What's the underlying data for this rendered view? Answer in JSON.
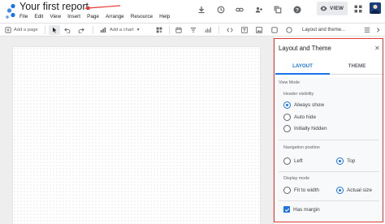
{
  "app": {
    "title": "Your first report",
    "menu": [
      "File",
      "Edit",
      "View",
      "Insert",
      "Page",
      "Arrange",
      "Resource",
      "Help"
    ],
    "top_icons": [
      "download-icon",
      "history-icon",
      "link-icon",
      "share-icon",
      "copy-icon",
      "help-icon"
    ],
    "view_button": "VIEW",
    "annotation_color": "#e53935",
    "accent": "#1a73e8"
  },
  "toolbar": {
    "add_page": "Add a page",
    "add_chart": "Add a chart",
    "theme_layout": "Layout and theme..."
  },
  "panel": {
    "title": "Layout and Theme",
    "tabs": {
      "layout": "LAYOUT",
      "theme": "THEME"
    },
    "view_mode": "View Mode",
    "header_visibility": "Header visibility",
    "header_options": [
      "Always show",
      "Auto hide",
      "Initially hidden"
    ],
    "header_selected": "Always show",
    "navigation_position": "Navigation position",
    "nav_left": "Left",
    "nav_top": "Top",
    "nav_selected": "Top",
    "display_mode": "Display mode",
    "fit_to_width": "Fit to width",
    "actual_size": "Actual size",
    "display_selected": "Actual size",
    "has_margin": "Has margin",
    "has_margin_checked": true
  }
}
